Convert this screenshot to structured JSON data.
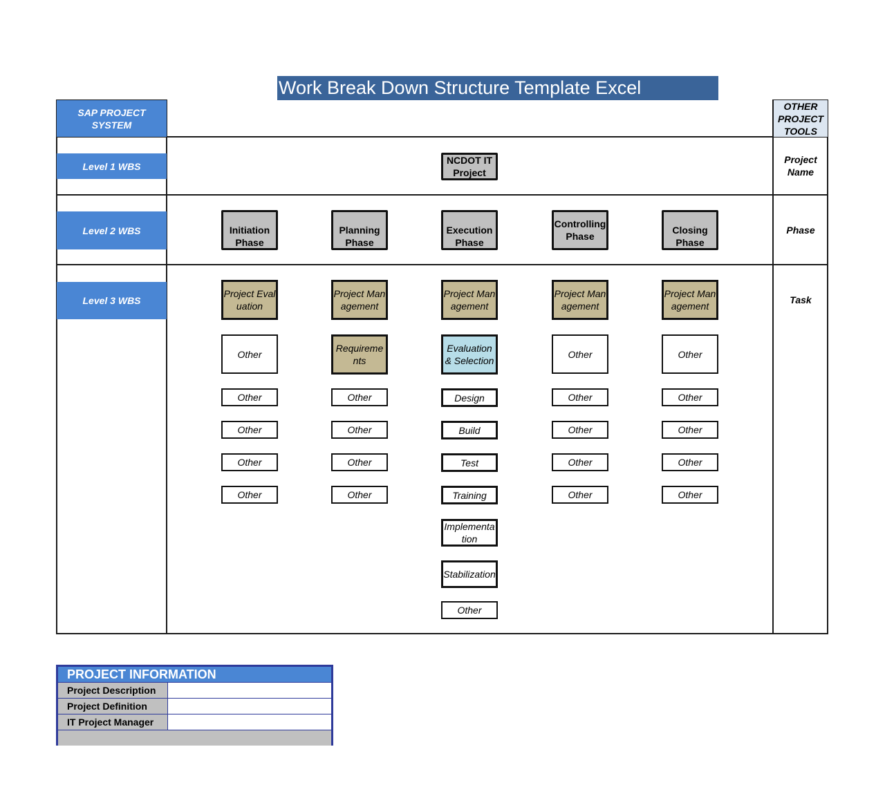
{
  "title": "Work Break Down Structure Template Excel",
  "left_column": {
    "header": "SAP PROJECT SYSTEM",
    "levels": [
      "Level 1 WBS",
      "Level 2 WBS",
      "Level 3 WBS"
    ]
  },
  "right_column": {
    "header": "OTHER PROJECT TOOLS",
    "labels": [
      "Project Name",
      "Phase",
      "Task"
    ]
  },
  "level1": {
    "label": "NCDOT IT Project"
  },
  "phases": [
    {
      "label": "Initiation Phase",
      "tasks": [
        {
          "label": "Project Evaluation",
          "style": "tan"
        },
        {
          "label": "Other",
          "style": "white-tall"
        },
        {
          "label": "Other",
          "style": "white"
        },
        {
          "label": "Other",
          "style": "white"
        },
        {
          "label": "Other",
          "style": "white"
        },
        {
          "label": "Other",
          "style": "white"
        }
      ]
    },
    {
      "label": "Planning Phase",
      "tasks": [
        {
          "label": "Project Management",
          "style": "tan"
        },
        {
          "label": "Requirements",
          "style": "tan"
        },
        {
          "label": "Other",
          "style": "white"
        },
        {
          "label": "Other",
          "style": "white"
        },
        {
          "label": "Other",
          "style": "white"
        },
        {
          "label": "Other",
          "style": "white"
        }
      ]
    },
    {
      "label": "Execution Phase",
      "tasks": [
        {
          "label": "Project Management",
          "style": "tan"
        },
        {
          "label": "Evaluation & Selection",
          "style": "blue"
        },
        {
          "label": "Design",
          "style": "exec"
        },
        {
          "label": "Build",
          "style": "exec"
        },
        {
          "label": "Test",
          "style": "exec"
        },
        {
          "label": "Training",
          "style": "exec"
        },
        {
          "label": "Implementation",
          "style": "exec-tall"
        },
        {
          "label": "Stabilization",
          "style": "exec-tall"
        },
        {
          "label": "Other",
          "style": "white"
        }
      ]
    },
    {
      "label": "Controlling Phase",
      "tasks": [
        {
          "label": "Project Management",
          "style": "tan"
        },
        {
          "label": "Other",
          "style": "white-tall"
        },
        {
          "label": "Other",
          "style": "white"
        },
        {
          "label": "Other",
          "style": "white"
        },
        {
          "label": "Other",
          "style": "white"
        },
        {
          "label": "Other",
          "style": "white"
        }
      ]
    },
    {
      "label": "Closing Phase",
      "tasks": [
        {
          "label": "Project Management",
          "style": "tan"
        },
        {
          "label": "Other",
          "style": "white-tall"
        },
        {
          "label": "Other",
          "style": "white"
        },
        {
          "label": "Other",
          "style": "white"
        },
        {
          "label": "Other",
          "style": "white"
        },
        {
          "label": "Other",
          "style": "white"
        }
      ]
    }
  ],
  "project_info": {
    "header": "PROJECT INFORMATION",
    "rows": [
      {
        "label": "Project Description",
        "value": ""
      },
      {
        "label": "Project Definition",
        "value": ""
      },
      {
        "label": "IT Project Manager",
        "value": ""
      }
    ]
  },
  "colors": {
    "title_bg": "#3a6499",
    "level_bg": "#4a86d4",
    "tools_bg": "#dce6f1",
    "phase_box": "#c0c0c0",
    "task_tan": "#c4b994",
    "task_blue": "#b7dde8"
  }
}
